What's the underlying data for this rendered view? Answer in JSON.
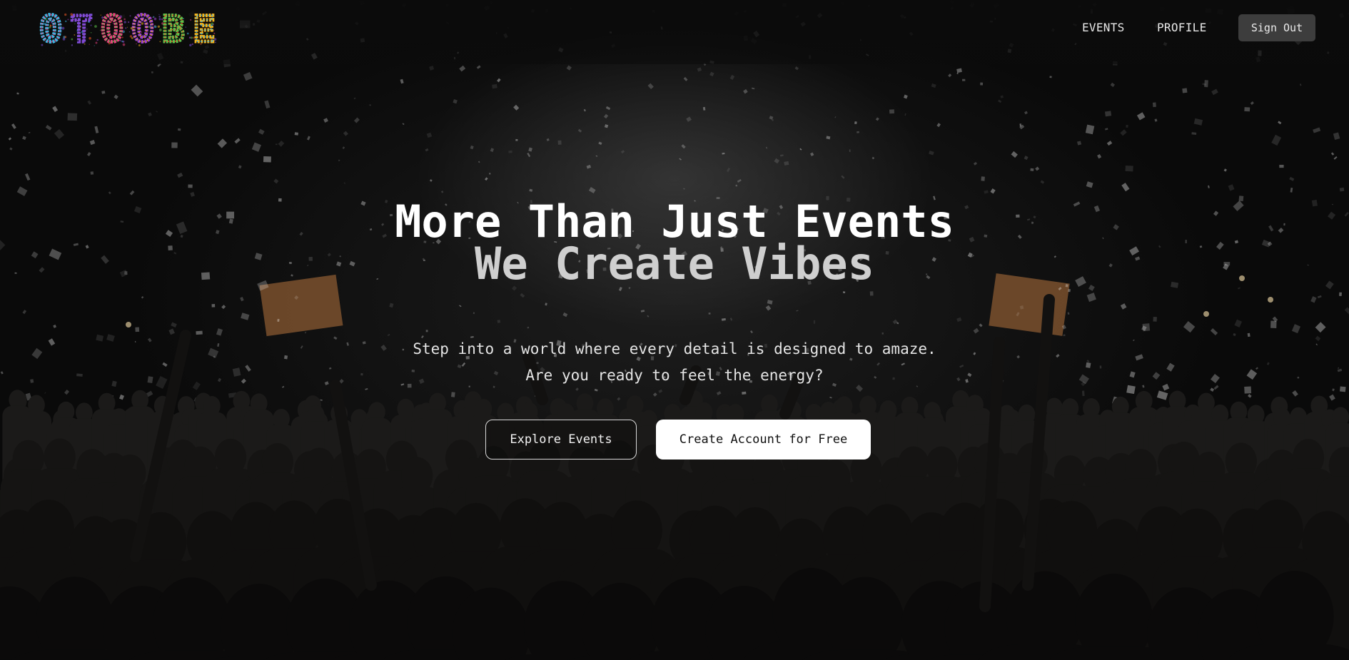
{
  "brand": {
    "logo_text": "OTOOBE",
    "logo_colors": [
      "#3db7e4",
      "#7b4fd6",
      "#e8417e",
      "#9b3fd1",
      "#5cc24a",
      "#f2b21b",
      "#f05a28"
    ]
  },
  "nav": {
    "items": [
      {
        "label": "EVENTS"
      },
      {
        "label": "PROFILE"
      }
    ],
    "signout_label": "Sign Out"
  },
  "hero": {
    "title": "More Than Just Events",
    "subtitle": "We Create Vibes",
    "text_line1": "Step into a world where every detail is designed to amaze.",
    "text_line2": "Are you ready to feel the energy?",
    "explore_label": "Explore Events",
    "create_label": "Create Account for Free"
  },
  "theme": {
    "background": "#080808",
    "signout_bg": "#3d3d3d",
    "subtitle_color": "#cfcfcf",
    "primary_button_bg": "#ffffff"
  }
}
